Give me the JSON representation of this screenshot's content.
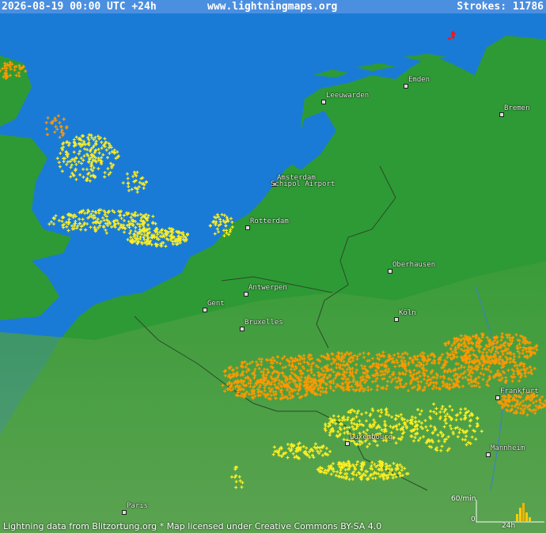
{
  "header": {
    "datetime": "2026-08-19 00:00 UTC +24h",
    "site": "www.lightningmaps.org",
    "strokes_label": "Strokes: 11786"
  },
  "cities": [
    {
      "name": "Emden"
    },
    {
      "name": "Leeuwarden"
    },
    {
      "name": "Bremen"
    },
    {
      "name": "Amsterdam"
    },
    {
      "name": "Schipol Airport"
    },
    {
      "name": "Rotterdam"
    },
    {
      "name": "Oberhausen"
    },
    {
      "name": "Antwerpen"
    },
    {
      "name": "Gent"
    },
    {
      "name": "Bruxelles"
    },
    {
      "name": "Köln"
    },
    {
      "name": "Frankfurt"
    },
    {
      "name": "Luxembourg"
    },
    {
      "name": "Mannheim"
    },
    {
      "name": "Paris"
    }
  ],
  "legend": {
    "rate_label": "60/min",
    "zero_label": "0",
    "time_label": "24h"
  },
  "footer": {
    "text": "Lightning data from Blitzortung.org  *  Map licensed under Creative Commons BY-SA 4.0"
  },
  "colors": {
    "sea": "#1a7bd6",
    "land": "#2e9a35",
    "highland": "#5c9e50",
    "strike_recent": "#ffee22",
    "strike_old": "#ff9900",
    "strike_newest": "#ff1111"
  }
}
